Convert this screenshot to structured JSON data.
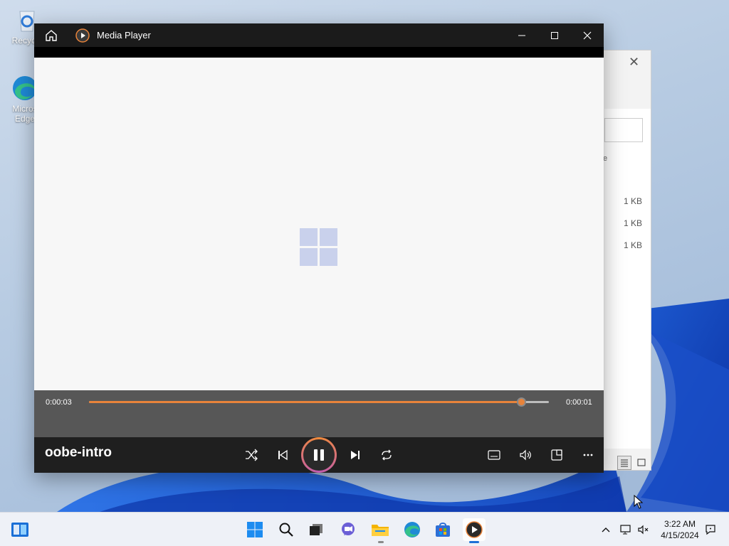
{
  "desktop": {
    "icons": [
      {
        "label": "Recycle",
        "icon": "recycle-bin-icon"
      },
      {
        "label": "Micros\nEdge",
        "icon": "edge-icon"
      }
    ]
  },
  "explorer_bg": {
    "fragment_text": "e",
    "sizes": [
      "1 KB",
      "1 KB",
      "1 KB"
    ]
  },
  "media_player": {
    "title": "Media Player",
    "time_elapsed": "0:00:03",
    "time_remaining": "0:00:01",
    "progress_fraction": 0.94,
    "media_title": "oobe-intro",
    "accent": "#e8833a"
  },
  "taskbar": {
    "time": "3:22 AM",
    "date": "4/15/2024"
  }
}
